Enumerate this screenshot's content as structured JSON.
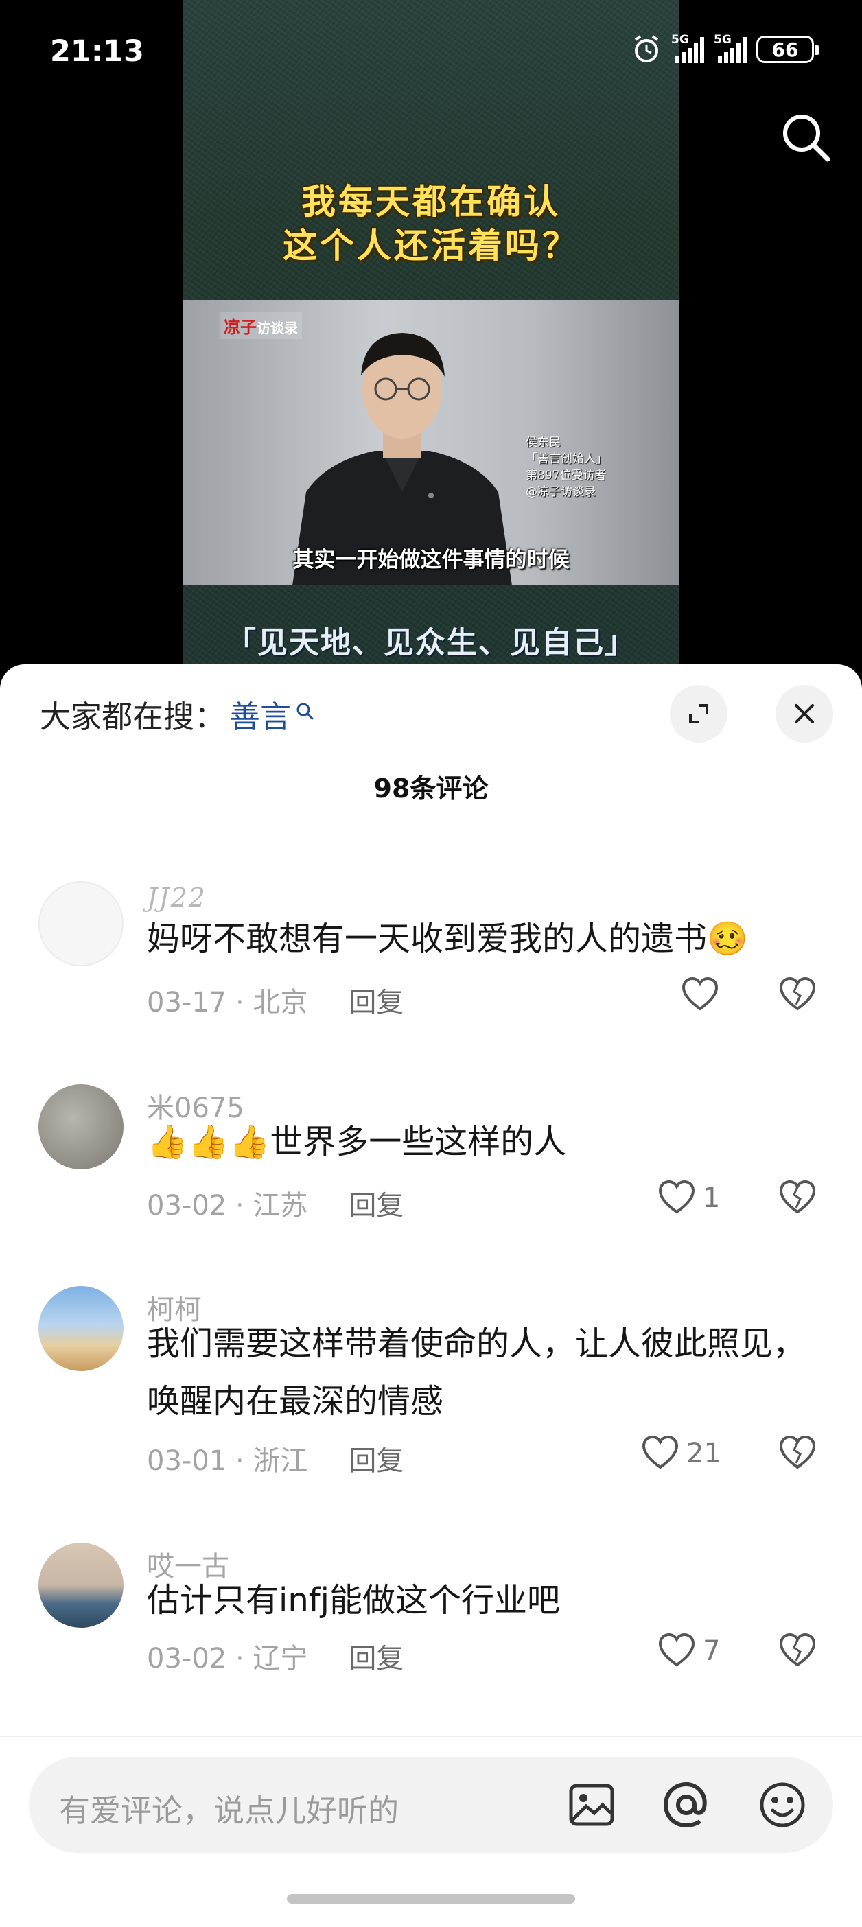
{
  "status_bar": {
    "time": "21:13",
    "network1": "5G",
    "network2": "5G",
    "battery": "66"
  },
  "video": {
    "headline_line1": "我每天都在确认",
    "headline_line2": "这个人还活着吗？",
    "brand_logo": "凉子",
    "brand_logo_sub": "访谈录",
    "guest_name": "侯东民",
    "guest_title": "「善言创始人」",
    "guest_number": "第897位受访者",
    "guest_source": "@凉子访谈录",
    "subtitle": "其实一开始做这件事情的时候",
    "bottom_line": "「见天地、见众生、见自己」"
  },
  "sheet": {
    "suggest_prefix": "大家都在搜：",
    "suggest_term": "善言",
    "comment_count": "98条评论"
  },
  "comments": [
    {
      "user": "JJ22",
      "text": "妈呀不敢想有一天收到爱我的人的遗书🥴",
      "date": "03-17 · 北京",
      "reply": "回复",
      "likes": ""
    },
    {
      "user": "米0675",
      "text": "👍👍👍世界多一些这样的人",
      "date": "03-02 · 江苏",
      "reply": "回复",
      "likes": "1"
    },
    {
      "user": "柯柯",
      "text": "我们需要这样带着使命的人，让人彼此照见，唤醒内在最深的情感",
      "date": "03-01 · 浙江",
      "reply": "回复",
      "likes": "21"
    },
    {
      "user": "哎一古",
      "text": "估计只有infj能做这个行业吧",
      "date": "03-02 · 辽宁",
      "reply": "回复",
      "likes": "7"
    }
  ],
  "input": {
    "placeholder": "有爱评论，说点儿好听的"
  },
  "icons": {
    "search": "search-icon",
    "expand": "expand-icon",
    "close": "close-icon",
    "like": "heart-icon",
    "dislike": "broken-heart-icon",
    "image": "image-icon",
    "mention": "at-icon",
    "emoji": "emoji-icon"
  }
}
